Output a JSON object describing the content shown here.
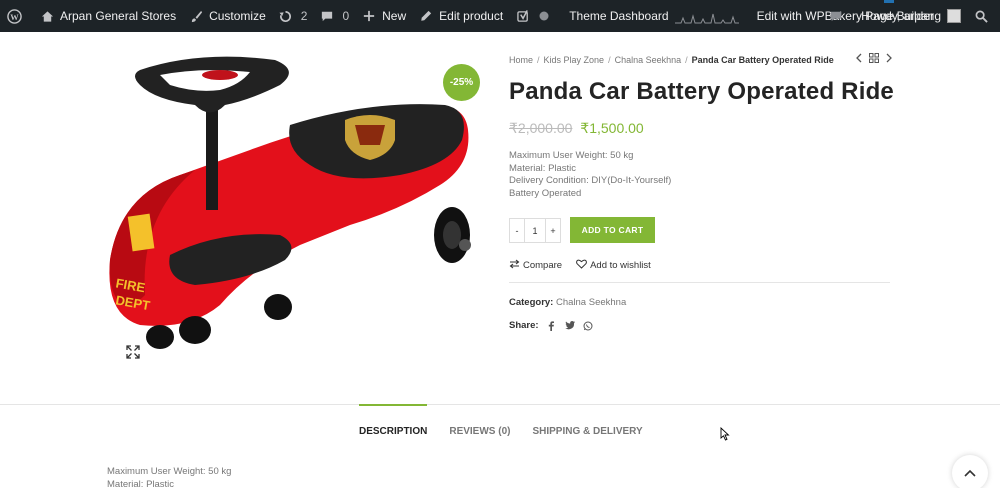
{
  "admin_bar": {
    "site_name": "Arpan General Stores",
    "customize": "Customize",
    "updates_count": "2",
    "comments_count": "0",
    "new_label": "New",
    "edit_product": "Edit product",
    "theme_dashboard": "Theme Dashboard",
    "wpbakery": "Edit with WPBakery Page Builder",
    "howdy": "Howdy, arpang"
  },
  "product": {
    "sale_badge": "-25%",
    "title": "Panda Car Battery Operated Ride",
    "old_price": "₹2,000.00",
    "new_price": "₹1,500.00",
    "description_lines": [
      "Maximum User Weight: 50 kg",
      "Material: Plastic",
      "Delivery Condition: DIY(Do-It-Yourself)",
      "Battery Operated"
    ],
    "quantity": "1",
    "qty_minus": "-",
    "qty_plus": "+",
    "add_to_cart": "ADD TO CART",
    "compare": "Compare",
    "wishlist": "Add to wishlist",
    "category_label": "Category:",
    "category_value": "Chalna Seekhna",
    "share_label": "Share:"
  },
  "breadcrumb": {
    "items": [
      "Home",
      "Kids Play Zone",
      "Chalna Seekhna"
    ],
    "current": "Panda Car Battery Operated Ride",
    "separator": "/"
  },
  "tabs": [
    {
      "label": "DESCRIPTION",
      "active": true
    },
    {
      "label": "REVIEWS (0)",
      "active": false
    },
    {
      "label": "SHIPPING & DELIVERY",
      "active": false
    }
  ],
  "bottom_description": [
    "Maximum User Weight: 50 kg",
    "Material: Plastic"
  ],
  "colors": {
    "accent": "#83b735",
    "admin_bar": "#1d2327",
    "toy_red": "#e3101b"
  },
  "icons": [
    "wordpress-icon",
    "home-icon",
    "brush-icon",
    "refresh-icon",
    "comment-icon",
    "plus-icon",
    "pencil-icon",
    "yoast-icon",
    "circle-icon",
    "search-icon",
    "chevron-left-icon",
    "grid-icon",
    "chevron-right-icon",
    "expand-icon",
    "compare-icon",
    "heart-icon",
    "facebook-icon",
    "twitter-icon",
    "whatsapp-icon",
    "chevron-up-icon"
  ]
}
